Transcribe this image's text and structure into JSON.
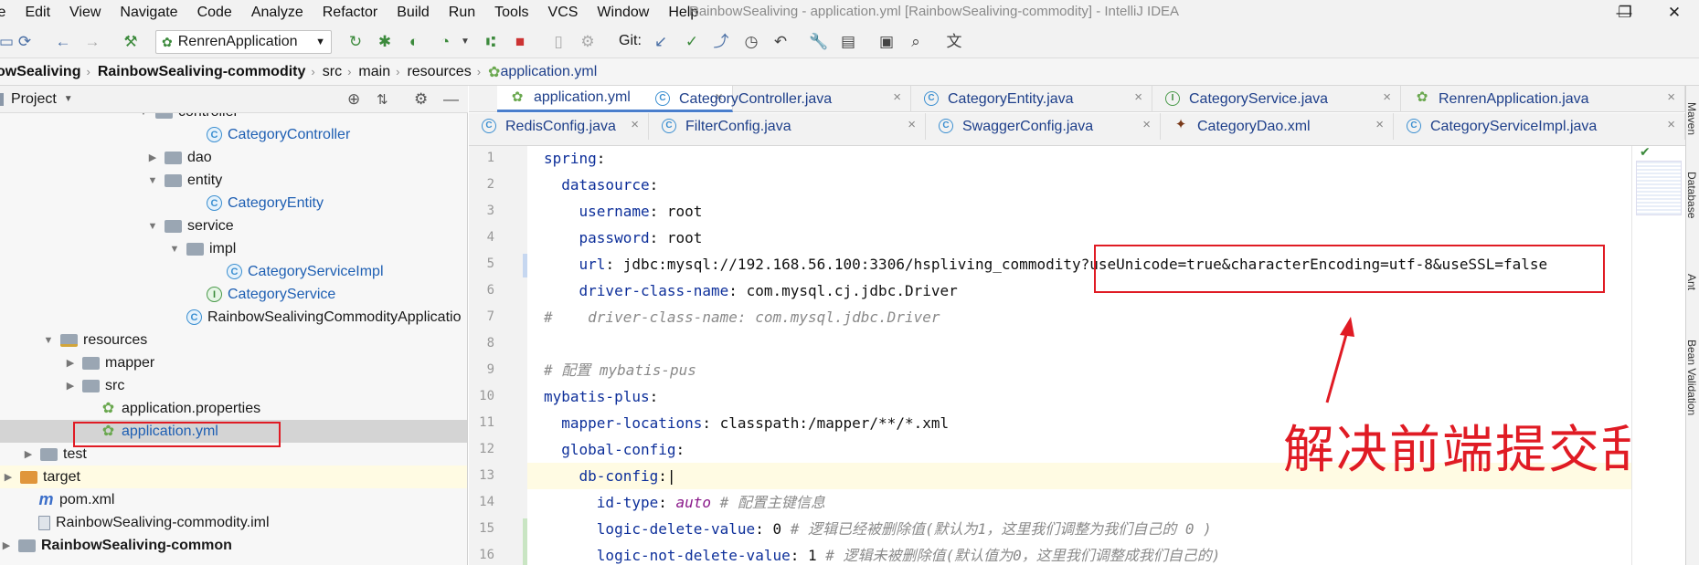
{
  "menu": [
    "le",
    "Edit",
    "View",
    "Navigate",
    "Code",
    "Analyze",
    "Refactor",
    "Build",
    "Run",
    "Tools",
    "VCS",
    "Window",
    "Help"
  ],
  "window_title": "RainbowSealiving - application.yml [RainbowSealiving-commodity] - IntelliJ IDEA",
  "window_controls": {
    "minimize": "—",
    "restore": "❐",
    "close": "✕"
  },
  "toolbar": {
    "run_config": "RenrenApplication",
    "git_label": "Git:"
  },
  "breadcrumb": [
    "owSealiving",
    "RainbowSealiving-commodity",
    "src",
    "main",
    "resources",
    "application.yml"
  ],
  "project_panel": {
    "title": "Project"
  },
  "tree": [
    {
      "label": "controller",
      "icon": "folder",
      "indent": 170,
      "twisty": "▼",
      "style": ""
    },
    {
      "label": "CategoryController",
      "icon": "class",
      "indent": 226,
      "twisty": "",
      "style": "blue"
    },
    {
      "label": "dao",
      "icon": "folder",
      "indent": 180,
      "twisty": "▶",
      "style": ""
    },
    {
      "label": "entity",
      "icon": "folder",
      "indent": 180,
      "twisty": "▼",
      "style": ""
    },
    {
      "label": "CategoryEntity",
      "icon": "class",
      "indent": 226,
      "twisty": "",
      "style": "blue"
    },
    {
      "label": "service",
      "icon": "folder",
      "indent": 180,
      "twisty": "▼",
      "style": ""
    },
    {
      "label": "impl",
      "icon": "folder",
      "indent": 204,
      "twisty": "▼",
      "style": ""
    },
    {
      "label": "CategoryServiceImpl",
      "icon": "class",
      "indent": 248,
      "twisty": "",
      "style": "blue"
    },
    {
      "label": "CategoryService",
      "icon": "iface",
      "indent": 226,
      "twisty": "",
      "style": "blue"
    },
    {
      "label": "RainbowSealivingCommodityApplicatio",
      "icon": "class",
      "indent": 204,
      "twisty": "",
      "style": ""
    },
    {
      "label": "resources",
      "icon": "folder-res",
      "indent": 66,
      "twisty": "▼",
      "style": ""
    },
    {
      "label": "mapper",
      "icon": "folder",
      "indent": 90,
      "twisty": "▶",
      "style": ""
    },
    {
      "label": "src",
      "icon": "folder",
      "indent": 90,
      "twisty": "▶",
      "style": ""
    },
    {
      "label": "application.properties",
      "icon": "spring",
      "indent": 110,
      "twisty": "",
      "style": ""
    },
    {
      "label": "application.yml",
      "icon": "spring",
      "indent": 110,
      "twisty": "",
      "style": "blue",
      "selected": true
    },
    {
      "label": "test",
      "icon": "folder",
      "indent": 44,
      "twisty": "▶",
      "style": ""
    },
    {
      "label": "target",
      "icon": "folder-orange",
      "indent": 22,
      "twisty": "▶",
      "style": "",
      "highlight": true
    },
    {
      "label": "pom.xml",
      "icon": "maven",
      "indent": 42,
      "twisty": "",
      "style": ""
    },
    {
      "label": "RainbowSealiving-commodity.iml",
      "icon": "file",
      "indent": 42,
      "twisty": "",
      "style": ""
    },
    {
      "label": "RainbowSealiving-common",
      "icon": "folder",
      "indent": 2,
      "twisty": "▶",
      "style": "bold"
    }
  ],
  "tabs_row1": [
    {
      "label": "application.yml",
      "icon": "spring",
      "active": true
    },
    {
      "label": "CategoryController.java",
      "icon": "class"
    },
    {
      "label": "CategoryEntity.java",
      "icon": "class"
    },
    {
      "label": "CategoryService.java",
      "icon": "iface"
    },
    {
      "label": "RenrenApplication.java",
      "icon": "spring"
    }
  ],
  "tabs_row2": [
    {
      "label": "RedisConfig.java",
      "icon": "class"
    },
    {
      "label": "FilterConfig.java",
      "icon": "class"
    },
    {
      "label": "SwaggerConfig.java",
      "icon": "class"
    },
    {
      "label": "CategoryDao.xml",
      "icon": "xml"
    },
    {
      "label": "CategoryServiceImpl.java",
      "icon": "class"
    }
  ],
  "code_lines": [
    {
      "n": "1",
      "indent": 0,
      "key": "spring",
      "sep": ":",
      "value": "",
      "comment": ""
    },
    {
      "n": "2",
      "indent": 2,
      "key": "datasource",
      "sep": ":",
      "value": "",
      "comment": ""
    },
    {
      "n": "3",
      "indent": 4,
      "key": "username",
      "sep": ": ",
      "value": "root",
      "comment": ""
    },
    {
      "n": "4",
      "indent": 4,
      "key": "password",
      "sep": ": ",
      "value": "root",
      "comment": ""
    },
    {
      "n": "5",
      "indent": 4,
      "key": "url",
      "sep": ": ",
      "value": "jdbc:mysql://192.168.56.100:3306/hspliving_commodity?useUnicode=true&characterEncoding=utf-8&useSSL=false",
      "comment": ""
    },
    {
      "n": "6",
      "indent": 4,
      "key": "driver-class-name",
      "sep": ": ",
      "value": "com.mysql.cj.jdbc.Driver",
      "comment": ""
    },
    {
      "n": "7",
      "indent": 0,
      "key": "",
      "sep": "",
      "value": "",
      "comment": "#    driver-class-name: com.mysql.jdbc.Driver"
    },
    {
      "n": "8",
      "indent": 0,
      "key": "",
      "sep": "",
      "value": "",
      "comment": ""
    },
    {
      "n": "9",
      "indent": 0,
      "key": "",
      "sep": "",
      "value": "",
      "comment": "# 配置 mybatis-pus"
    },
    {
      "n": "10",
      "indent": 0,
      "key": "mybatis-plus",
      "sep": ":",
      "value": "",
      "comment": ""
    },
    {
      "n": "11",
      "indent": 2,
      "key": "mapper-locations",
      "sep": ": ",
      "value": "classpath:/mapper/**/*.xml",
      "comment": ""
    },
    {
      "n": "12",
      "indent": 2,
      "key": "global-config",
      "sep": ":",
      "value": "",
      "comment": ""
    },
    {
      "n": "13",
      "indent": 4,
      "key": "db-config",
      "sep": ":",
      "value": "",
      "comment": "",
      "current": true
    },
    {
      "n": "14",
      "indent": 6,
      "key": "id-type",
      "sep": ": ",
      "value": "auto",
      "comment": " # 配置主键信息",
      "auto": true
    },
    {
      "n": "15",
      "indent": 6,
      "key": "logic-delete-value",
      "sep": ": ",
      "value": "0",
      "comment": " # 逻辑已经被删除值(默认为1，这里我们调整为我们自己的 0 )"
    },
    {
      "n": "16",
      "indent": 6,
      "key": "logic-not-delete-value",
      "sep": ": ",
      "value": "1",
      "comment": " # 逻辑未被删除值(默认值为0，这里我们调整成我们自己的)"
    }
  ],
  "annotation": "解决前端提交乱码",
  "right_strip": [
    "Maven",
    "Database",
    "Ant",
    "Bean Validation"
  ],
  "colors": {
    "accent_red": "#e01b24",
    "key_blue": "#0d2f9a",
    "tab_blue": "#1e3f8a"
  }
}
